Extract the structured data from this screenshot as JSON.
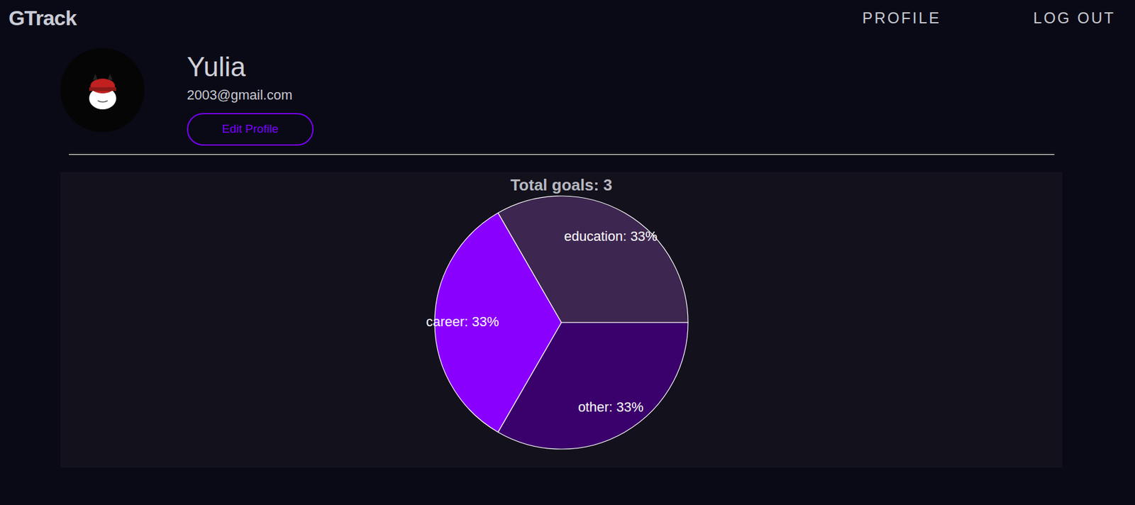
{
  "header": {
    "logo": "GTrack",
    "nav": [
      {
        "label": "PROFILE",
        "selected": false
      },
      {
        "label": "LOG OUT",
        "selected": false
      }
    ]
  },
  "profile": {
    "name": "Yulia",
    "email": "2003@gmail.com",
    "edit_button": "Edit Profile"
  },
  "chart": {
    "title": "Total goals: 3",
    "slices": [
      {
        "label": "education: 33%",
        "value": 1,
        "color": "#3d2650"
      },
      {
        "label": "other: 33%",
        "value": 1,
        "color": "#3a006b"
      },
      {
        "label": "career: 33%",
        "value": 1,
        "color": "#8a00ff"
      }
    ]
  }
}
